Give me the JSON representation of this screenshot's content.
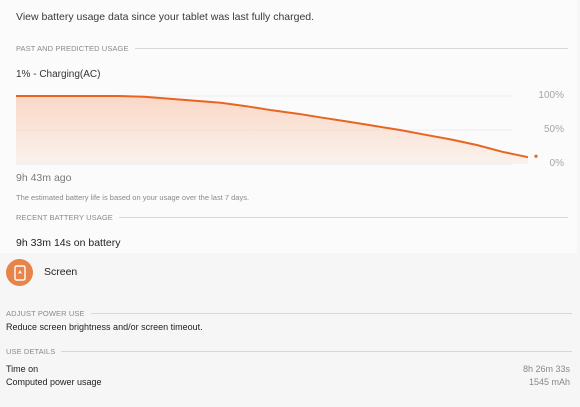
{
  "intro_text": "View battery usage data since your tablet was last fully charged.",
  "past_predicted": {
    "header": "PAST AND PREDICTED USAGE",
    "charging_status": "1% - Charging(AC)",
    "y_labels": [
      "100%",
      "50%",
      "0%"
    ],
    "elapsed": "9h 43m ago",
    "estimate_note": "The estimated battery life is based on your usage over the last 7 days."
  },
  "chart_data": {
    "type": "area",
    "x": [
      0,
      0.05,
      0.1,
      0.15,
      0.2,
      0.25,
      0.3,
      0.35,
      0.4,
      0.45,
      0.5,
      0.55,
      0.6,
      0.65,
      0.7,
      0.75,
      0.8,
      0.85,
      0.9,
      0.95,
      1.0
    ],
    "values": [
      100,
      100,
      100,
      100,
      100,
      99,
      96,
      93,
      90,
      85,
      79,
      74,
      68,
      62,
      56,
      50,
      43,
      36,
      28,
      18,
      10
    ],
    "ylim": [
      0,
      100
    ],
    "color": "#e8651f",
    "fill_color": "#f9d6c4"
  },
  "recent": {
    "header": "RECENT BATTERY USAGE",
    "on_battery": "9h 33m 14s on battery",
    "app": {
      "name": "Screen",
      "icon": "tablet-icon",
      "icon_color": "#e8844a"
    }
  },
  "adjust": {
    "header": "ADJUST POWER USE",
    "text": "Reduce screen brightness and/or screen timeout."
  },
  "use_details": {
    "header": "USE DETAILS",
    "rows": [
      {
        "label": "Time on",
        "value": "8h 26m 33s"
      },
      {
        "label": "Computed power usage",
        "value": "1545 mAh"
      }
    ]
  }
}
